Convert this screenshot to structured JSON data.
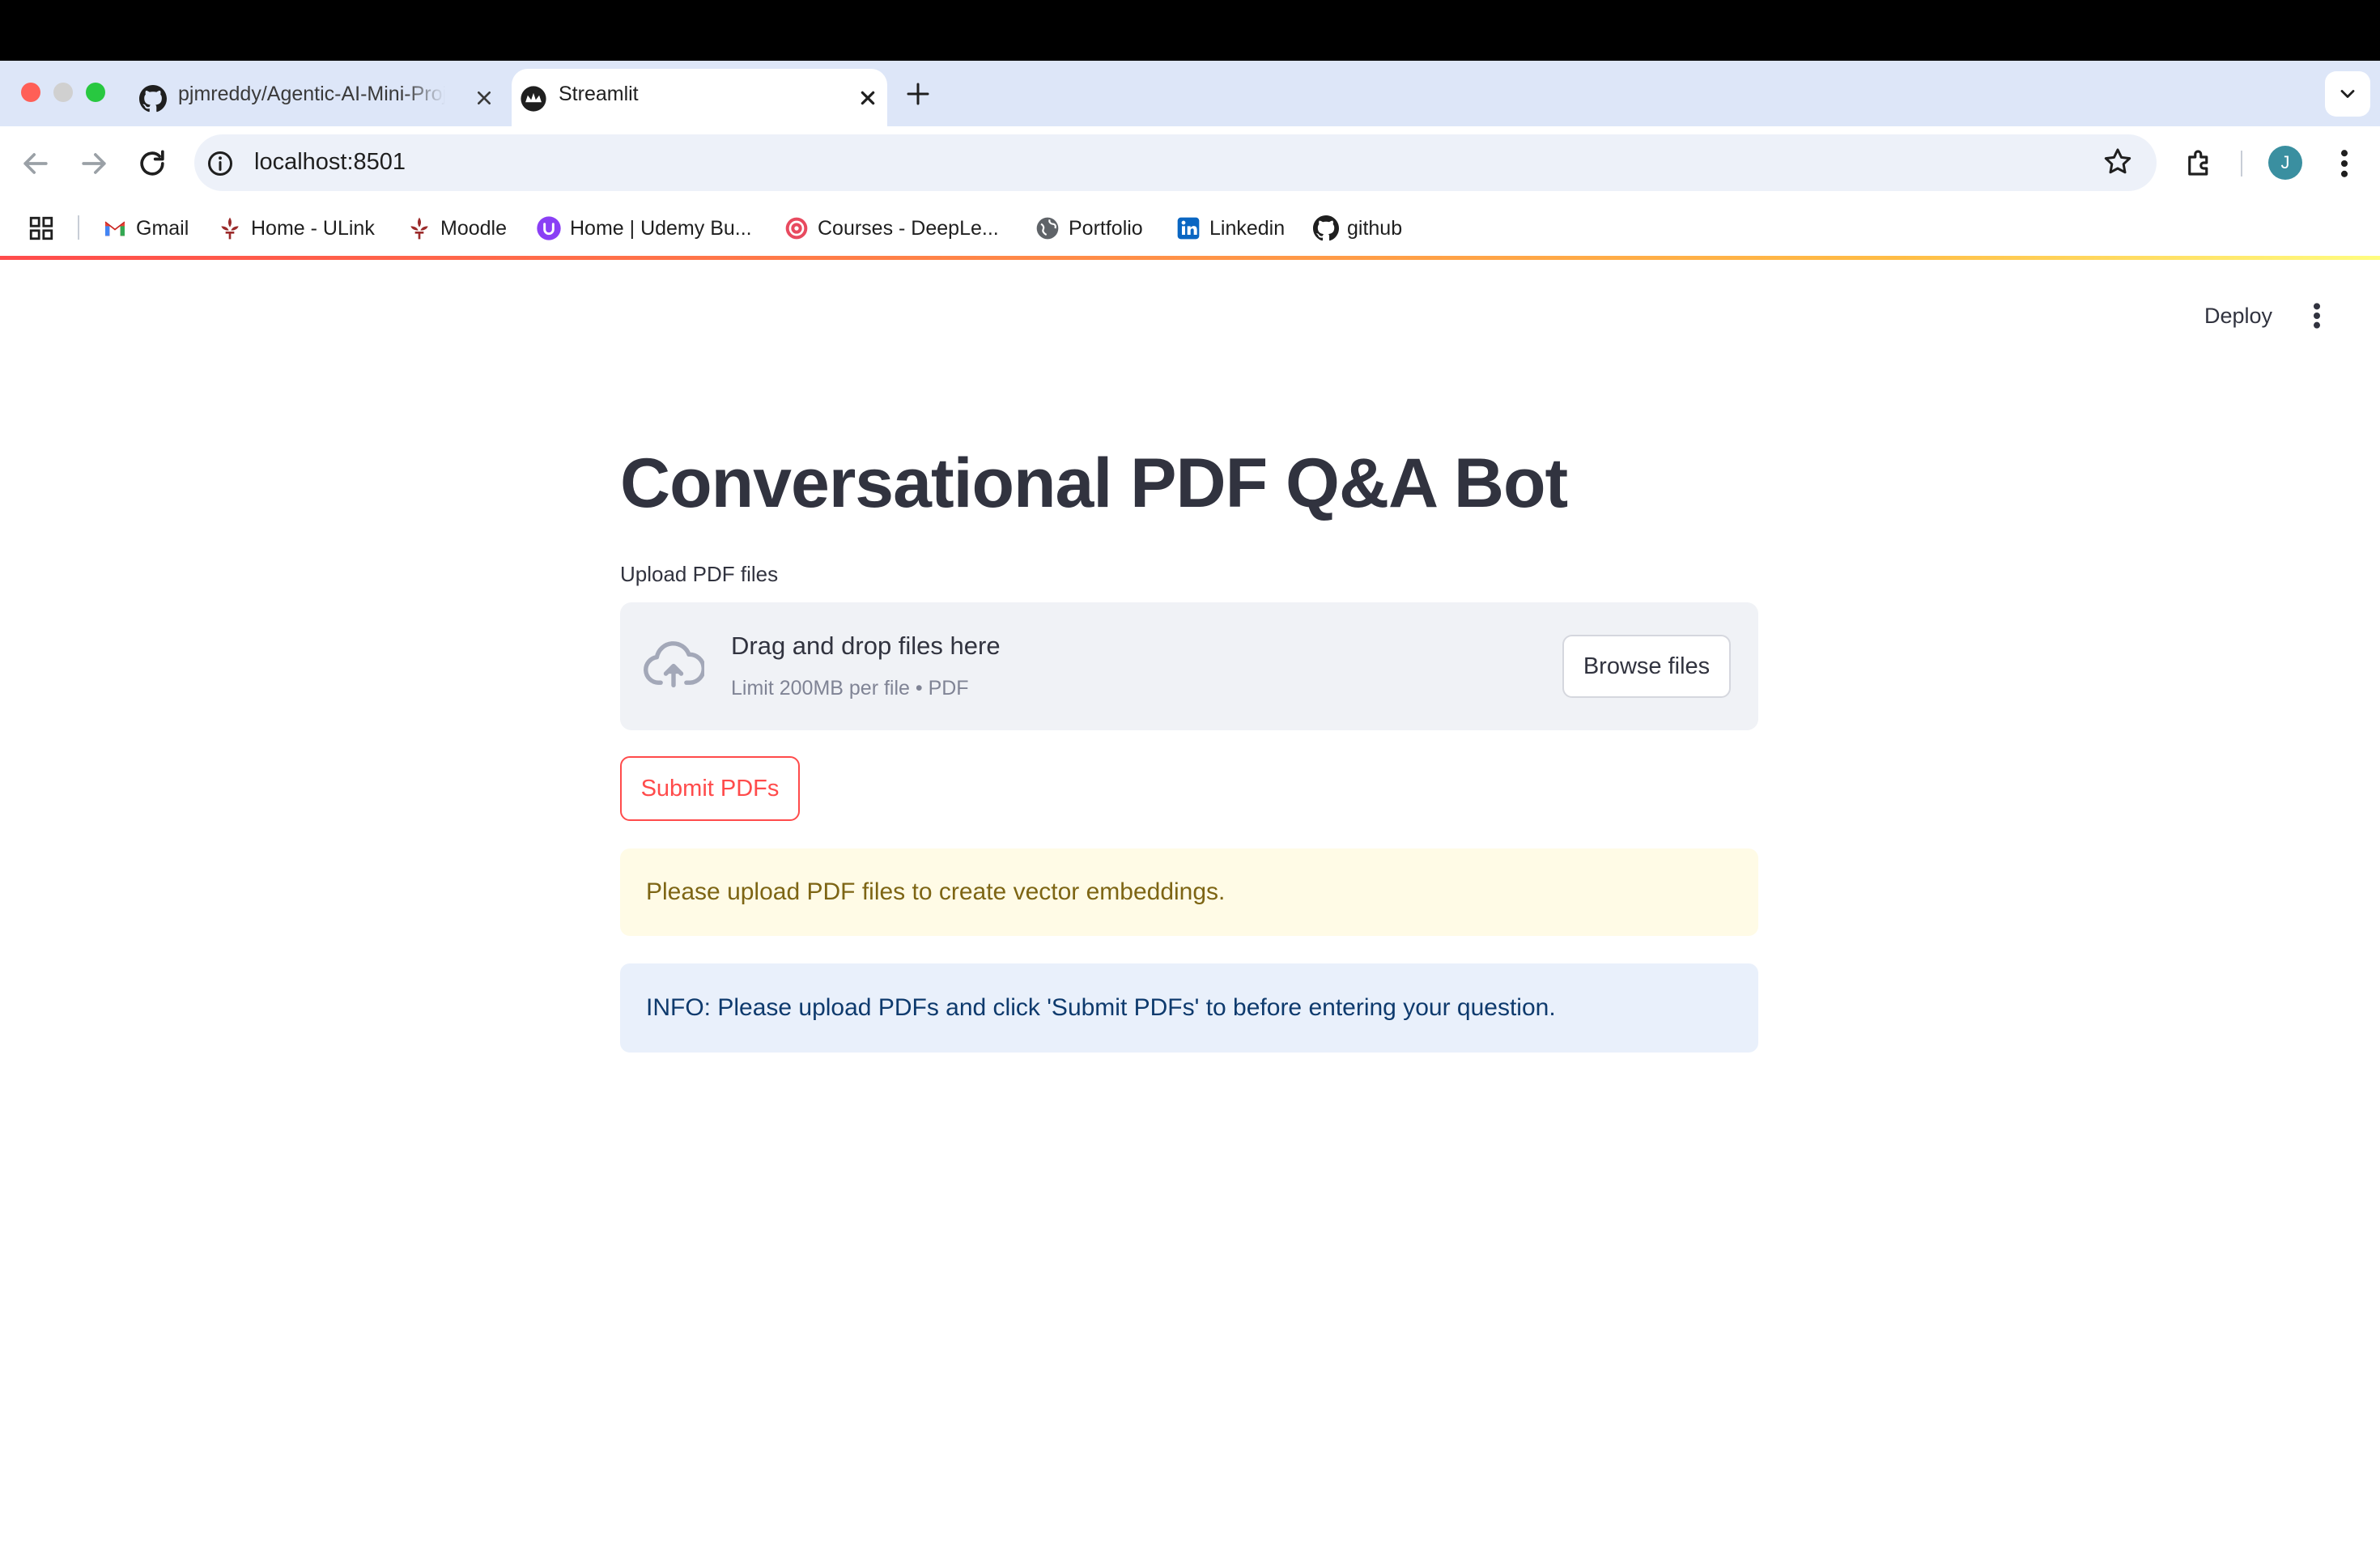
{
  "browser": {
    "tabs": [
      {
        "title": "pjmreddy/Agentic-AI-Mini-Projects",
        "icon": "github-icon",
        "active": false
      },
      {
        "title": "Streamlit",
        "icon": "streamlit-icon",
        "active": true
      }
    ],
    "address": "localhost:8501",
    "profile_initial": "J",
    "bookmarks": [
      {
        "label": "Gmail",
        "icon": "gmail-icon"
      },
      {
        "label": "Home - ULink",
        "icon": "fleur-de-lis-icon"
      },
      {
        "label": "Moodle",
        "icon": "fleur-de-lis-icon"
      },
      {
        "label": "Home | Udemy Bu...",
        "icon": "udemy-icon"
      },
      {
        "label": "Courses - DeepLe...",
        "icon": "deeplearning-icon"
      },
      {
        "label": "Portfolio",
        "icon": "globe-icon"
      },
      {
        "label": "Linkedin",
        "icon": "linkedin-icon"
      },
      {
        "label": "github",
        "icon": "github-icon"
      }
    ]
  },
  "app": {
    "deploy_label": "Deploy",
    "title": "Conversational PDF Q&A Bot",
    "uploader": {
      "label": "Upload PDF files",
      "drop_text": "Drag and drop files here",
      "limit_text": "Limit 200MB per file • PDF",
      "browse_label": "Browse files"
    },
    "submit_label": "Submit PDFs",
    "warning_text": "Please upload PDF files to create vector embeddings.",
    "info_text": "INFO: Please upload PDFs and click 'Submit PDFs' to before entering your question."
  },
  "colors": {
    "accent": "#ff4b4b",
    "warning_bg": "#fffbe6",
    "info_bg": "#e9f0fb"
  }
}
